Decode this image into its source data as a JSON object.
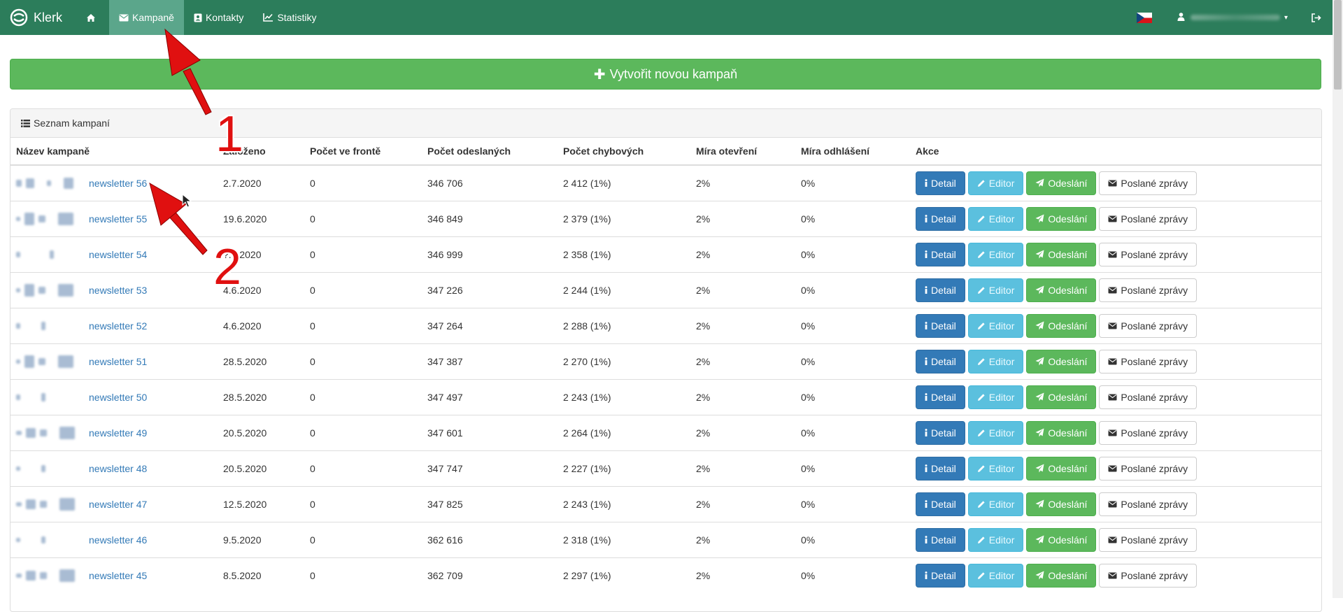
{
  "colors": {
    "navbar": "#2c7d5b",
    "nav_active": "#5ba68b",
    "primary": "#337ab7",
    "info": "#5bc0de",
    "success": "#5cb85c",
    "annotation": "#e01010"
  },
  "navbar": {
    "brand": "Klerk",
    "items": [
      {
        "label": "",
        "icon": "home-icon"
      },
      {
        "label": "Kampaně",
        "icon": "envelope-icon",
        "active": true
      },
      {
        "label": "Kontakty",
        "icon": "contact-card-icon"
      },
      {
        "label": "Statistiky",
        "icon": "line-chart-icon"
      }
    ],
    "flag": "czech-flag-icon",
    "user_icon": "user-icon",
    "logout_icon": "logout-icon"
  },
  "create_button": {
    "label": "Vytvořit novou kampaň",
    "icon": "plus-icon"
  },
  "panel": {
    "title": "Seznam kampaní",
    "icon": "list-icon"
  },
  "table": {
    "headers": [
      "Název kampaně",
      "Založeno",
      "Počet ve frontě",
      "Počet odeslaných",
      "Počet chybových",
      "Míra otevření",
      "Míra odhlášení",
      "Akce"
    ],
    "action_labels": {
      "detail": "Detail",
      "editor": "Editor",
      "send": "Odeslání",
      "sent": "Poslané zprávy"
    },
    "rows": [
      {
        "name": "newsletter 56",
        "date": "2.7.2020",
        "queue": "0",
        "sent": "346 706",
        "errors": "2 412 (1%)",
        "open": "2%",
        "unsub": "0%"
      },
      {
        "name": "newsletter 55",
        "date": "19.6.2020",
        "queue": "0",
        "sent": "346 849",
        "errors": "2 379 (1%)",
        "open": "2%",
        "unsub": "0%"
      },
      {
        "name": "newsletter 54",
        "date": "?.6.2020",
        "queue": "0",
        "sent": "346 999",
        "errors": "2 358 (1%)",
        "open": "2%",
        "unsub": "0%"
      },
      {
        "name": "newsletter 53",
        "date": "4.6.2020",
        "queue": "0",
        "sent": "347 226",
        "errors": "2 244 (1%)",
        "open": "2%",
        "unsub": "0%"
      },
      {
        "name": "newsletter 52",
        "date": "4.6.2020",
        "queue": "0",
        "sent": "347 264",
        "errors": "2 288 (1%)",
        "open": "2%",
        "unsub": "0%"
      },
      {
        "name": "newsletter 51",
        "date": "28.5.2020",
        "queue": "0",
        "sent": "347 387",
        "errors": "2 270 (1%)",
        "open": "2%",
        "unsub": "0%"
      },
      {
        "name": "newsletter 50",
        "date": "28.5.2020",
        "queue": "0",
        "sent": "347 497",
        "errors": "2 243 (1%)",
        "open": "2%",
        "unsub": "0%"
      },
      {
        "name": "newsletter 49",
        "date": "20.5.2020",
        "queue": "0",
        "sent": "347 601",
        "errors": "2 264 (1%)",
        "open": "2%",
        "unsub": "0%"
      },
      {
        "name": "newsletter 48",
        "date": "20.5.2020",
        "queue": "0",
        "sent": "347 747",
        "errors": "2 227 (1%)",
        "open": "2%",
        "unsub": "0%"
      },
      {
        "name": "newsletter 47",
        "date": "12.5.2020",
        "queue": "0",
        "sent": "347 825",
        "errors": "2 243 (1%)",
        "open": "2%",
        "unsub": "0%"
      },
      {
        "name": "newsletter 46",
        "date": "9.5.2020",
        "queue": "0",
        "sent": "362 616",
        "errors": "2 318 (1%)",
        "open": "2%",
        "unsub": "0%"
      },
      {
        "name": "newsletter 45",
        "date": "8.5.2020",
        "queue": "0",
        "sent": "362 709",
        "errors": "2 297 (1%)",
        "open": "2%",
        "unsub": "0%"
      }
    ]
  },
  "annotations": [
    {
      "number": "1"
    },
    {
      "number": "2"
    }
  ]
}
